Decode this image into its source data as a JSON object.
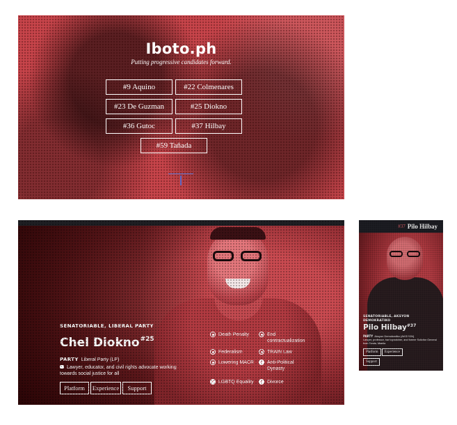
{
  "hero": {
    "title": "Iboto.ph",
    "tagline": "Putting progressive candidates forward.",
    "candidates": [
      "#9 Aquino",
      "#22 Colmenares",
      "#23 De Guzman",
      "#25 Diokno",
      "#36 Gutoc",
      "#37 Hilbay",
      "#59 Tañada"
    ]
  },
  "candidate": {
    "kicker": "SENATORIABLE, LIBERAL PARTY",
    "name": "Chel Diokno",
    "number": "#25",
    "party_label": "PARTY",
    "party_value": "Liberal Party (LP)",
    "description": "Lawyer, educator, and civil rights advocate working towards social justice for all",
    "tabs": [
      "Platform",
      "Experience",
      "Support"
    ],
    "issues": [
      {
        "label": "Death Penalty",
        "stance": "against"
      },
      {
        "label": "End contractualization",
        "stance": "for"
      },
      {
        "label": "Federalism",
        "stance": "against"
      },
      {
        "label": "TRAIN Law",
        "stance": "for"
      },
      {
        "label": "Lowering MACR",
        "stance": "against"
      },
      {
        "label": "Anti-Political Dynasty",
        "stance": "for"
      },
      {
        "label": "LGBTQ Equality",
        "stance": "for"
      },
      {
        "label": "Divorce",
        "stance": "for"
      }
    ]
  },
  "mobile": {
    "number": "#37",
    "name": "Pilo Hilbay",
    "kicker": "SENATORIABLE, AKSYON DEMOKRATIKO",
    "name_full": "Pilo Hilbay",
    "sup": "#37",
    "party_label": "PARTY",
    "party_value": "Aksyon Demokratiko (AKSYON)",
    "description": "Lawyer, professor, bar topnotcher, and former Solicitor General from Tondo, Manila",
    "tabs": [
      "Platform",
      "Experience",
      "Support"
    ]
  },
  "colors": {
    "accent_red": "#c8454b",
    "dark_bar": "#1f1f23",
    "scroll_indicator": "#6a7cd8"
  }
}
